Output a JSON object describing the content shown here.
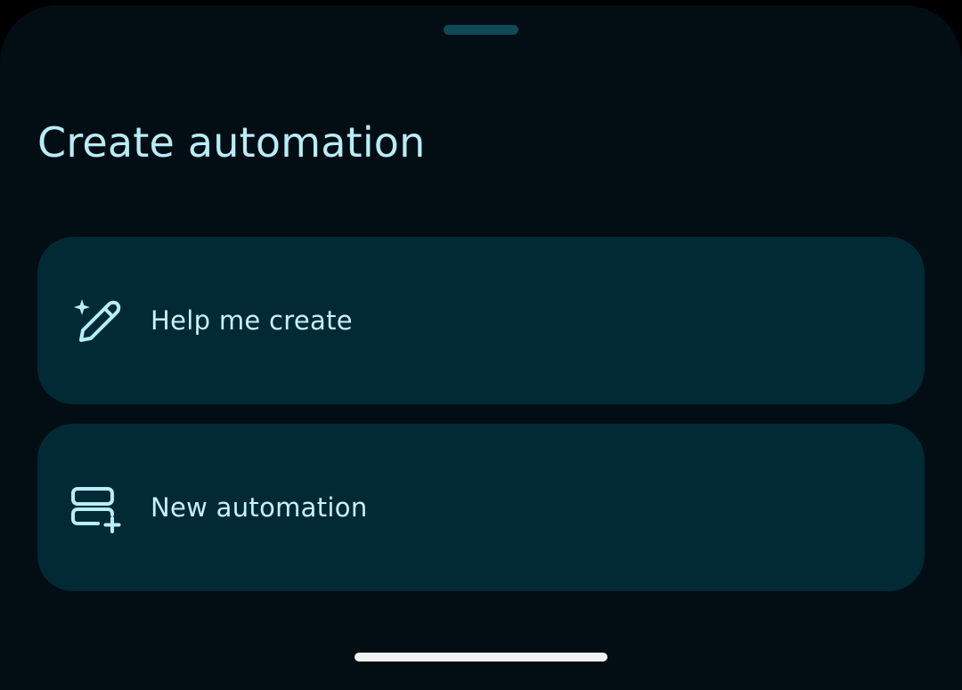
{
  "sheet": {
    "title": "Create automation"
  },
  "options": [
    {
      "label": "Help me create",
      "icon": "sparkle-pen-icon"
    },
    {
      "label": "New automation",
      "icon": "add-automation-icon"
    }
  ],
  "colors": {
    "sheet_background": "#020e14",
    "card_background": "#012a35",
    "title_text": "#b9ecf7",
    "label_text": "#c7f1fb",
    "icon": "#b7eefb",
    "drag_handle": "#0f4a57",
    "home_indicator": "#f2f2f2"
  }
}
